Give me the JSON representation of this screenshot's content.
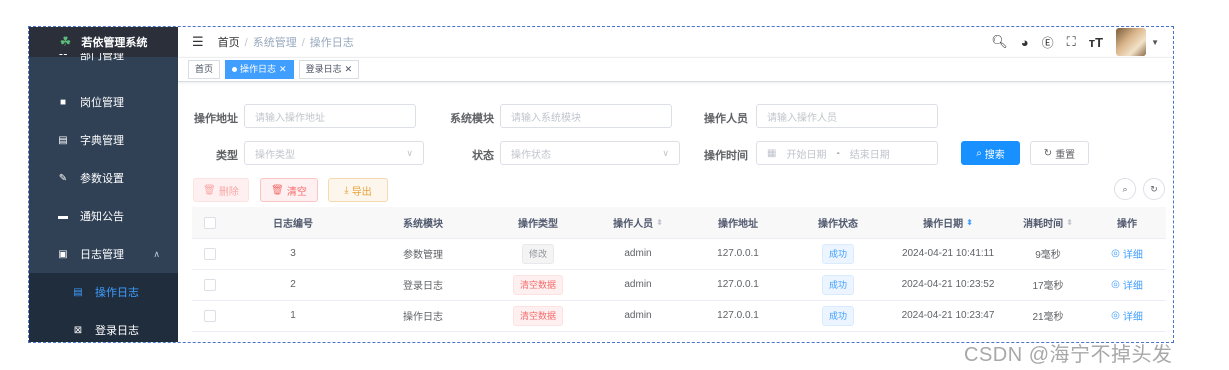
{
  "app": {
    "title": "若依管理系统"
  },
  "sidebar": {
    "items": [
      {
        "label": "部门管理",
        "icon": "tree-icon"
      },
      {
        "label": "岗位管理",
        "icon": "post-icon"
      },
      {
        "label": "字典管理",
        "icon": "dict-icon"
      },
      {
        "label": "参数设置",
        "icon": "edit-icon"
      },
      {
        "label": "通知公告",
        "icon": "message-icon"
      },
      {
        "label": "日志管理",
        "icon": "log-icon",
        "expanded": true
      },
      {
        "label": "操作日志",
        "icon": "form-icon",
        "active": true
      },
      {
        "label": "登录日志",
        "icon": "logininfor-icon"
      }
    ]
  },
  "navbar": {
    "breadcrumb": [
      "首页",
      "系统管理",
      "操作日志"
    ],
    "breadcrumb_sep": "/",
    "icons": [
      "search-icon",
      "github-icon",
      "question-icon",
      "fullscreen-icon",
      "font-size-icon",
      "avatar"
    ]
  },
  "tags": [
    {
      "label": "首页",
      "active": false,
      "closable": false
    },
    {
      "label": "操作日志",
      "active": true,
      "closable": true
    },
    {
      "label": "登录日志",
      "active": false,
      "closable": true
    }
  ],
  "search": {
    "oper_ip": {
      "label": "操作地址",
      "placeholder": "请输入操作地址"
    },
    "title": {
      "label": "系统模块",
      "placeholder": "请输入系统模块"
    },
    "oper_name": {
      "label": "操作人员",
      "placeholder": "请输入操作人员"
    },
    "business_type": {
      "label": "类型",
      "placeholder": "操作类型"
    },
    "status": {
      "label": "状态",
      "placeholder": "操作状态"
    },
    "oper_time": {
      "label": "操作时间",
      "start_placeholder": "开始日期",
      "range_sep": "-",
      "end_placeholder": "结束日期"
    },
    "search_button": "搜索",
    "reset_button": "重置"
  },
  "toolbar": {
    "delete_label": "删除",
    "clean_label": "清空",
    "export_label": "导出"
  },
  "table": {
    "columns": [
      "日志编号",
      "系统模块",
      "操作类型",
      "操作人员",
      "操作地址",
      "操作状态",
      "操作日期",
      "消耗时间",
      "操作"
    ],
    "rows": [
      {
        "id": "3",
        "module": "参数管理",
        "type": "修改",
        "type_style": "info",
        "user": "admin",
        "ip": "127.0.0.1",
        "status": "成功",
        "date": "2024-04-21 10:41:11",
        "cost": "9毫秒",
        "action": "详细"
      },
      {
        "id": "2",
        "module": "登录日志",
        "type": "清空数据",
        "type_style": "danger",
        "user": "admin",
        "ip": "127.0.0.1",
        "status": "成功",
        "date": "2024-04-21 10:23:52",
        "cost": "17毫秒",
        "action": "详细"
      },
      {
        "id": "1",
        "module": "操作日志",
        "type": "清空数据",
        "type_style": "danger",
        "user": "admin",
        "ip": "127.0.0.1",
        "status": "成功",
        "date": "2024-04-21 10:23:47",
        "cost": "21毫秒",
        "action": "详细"
      }
    ]
  },
  "watermark": "CSDN @海宁不掉头发",
  "colors": {
    "sidebar": "#304156",
    "primary": "#409eff",
    "danger": "#f56c6c",
    "warning": "#e6a23c"
  }
}
